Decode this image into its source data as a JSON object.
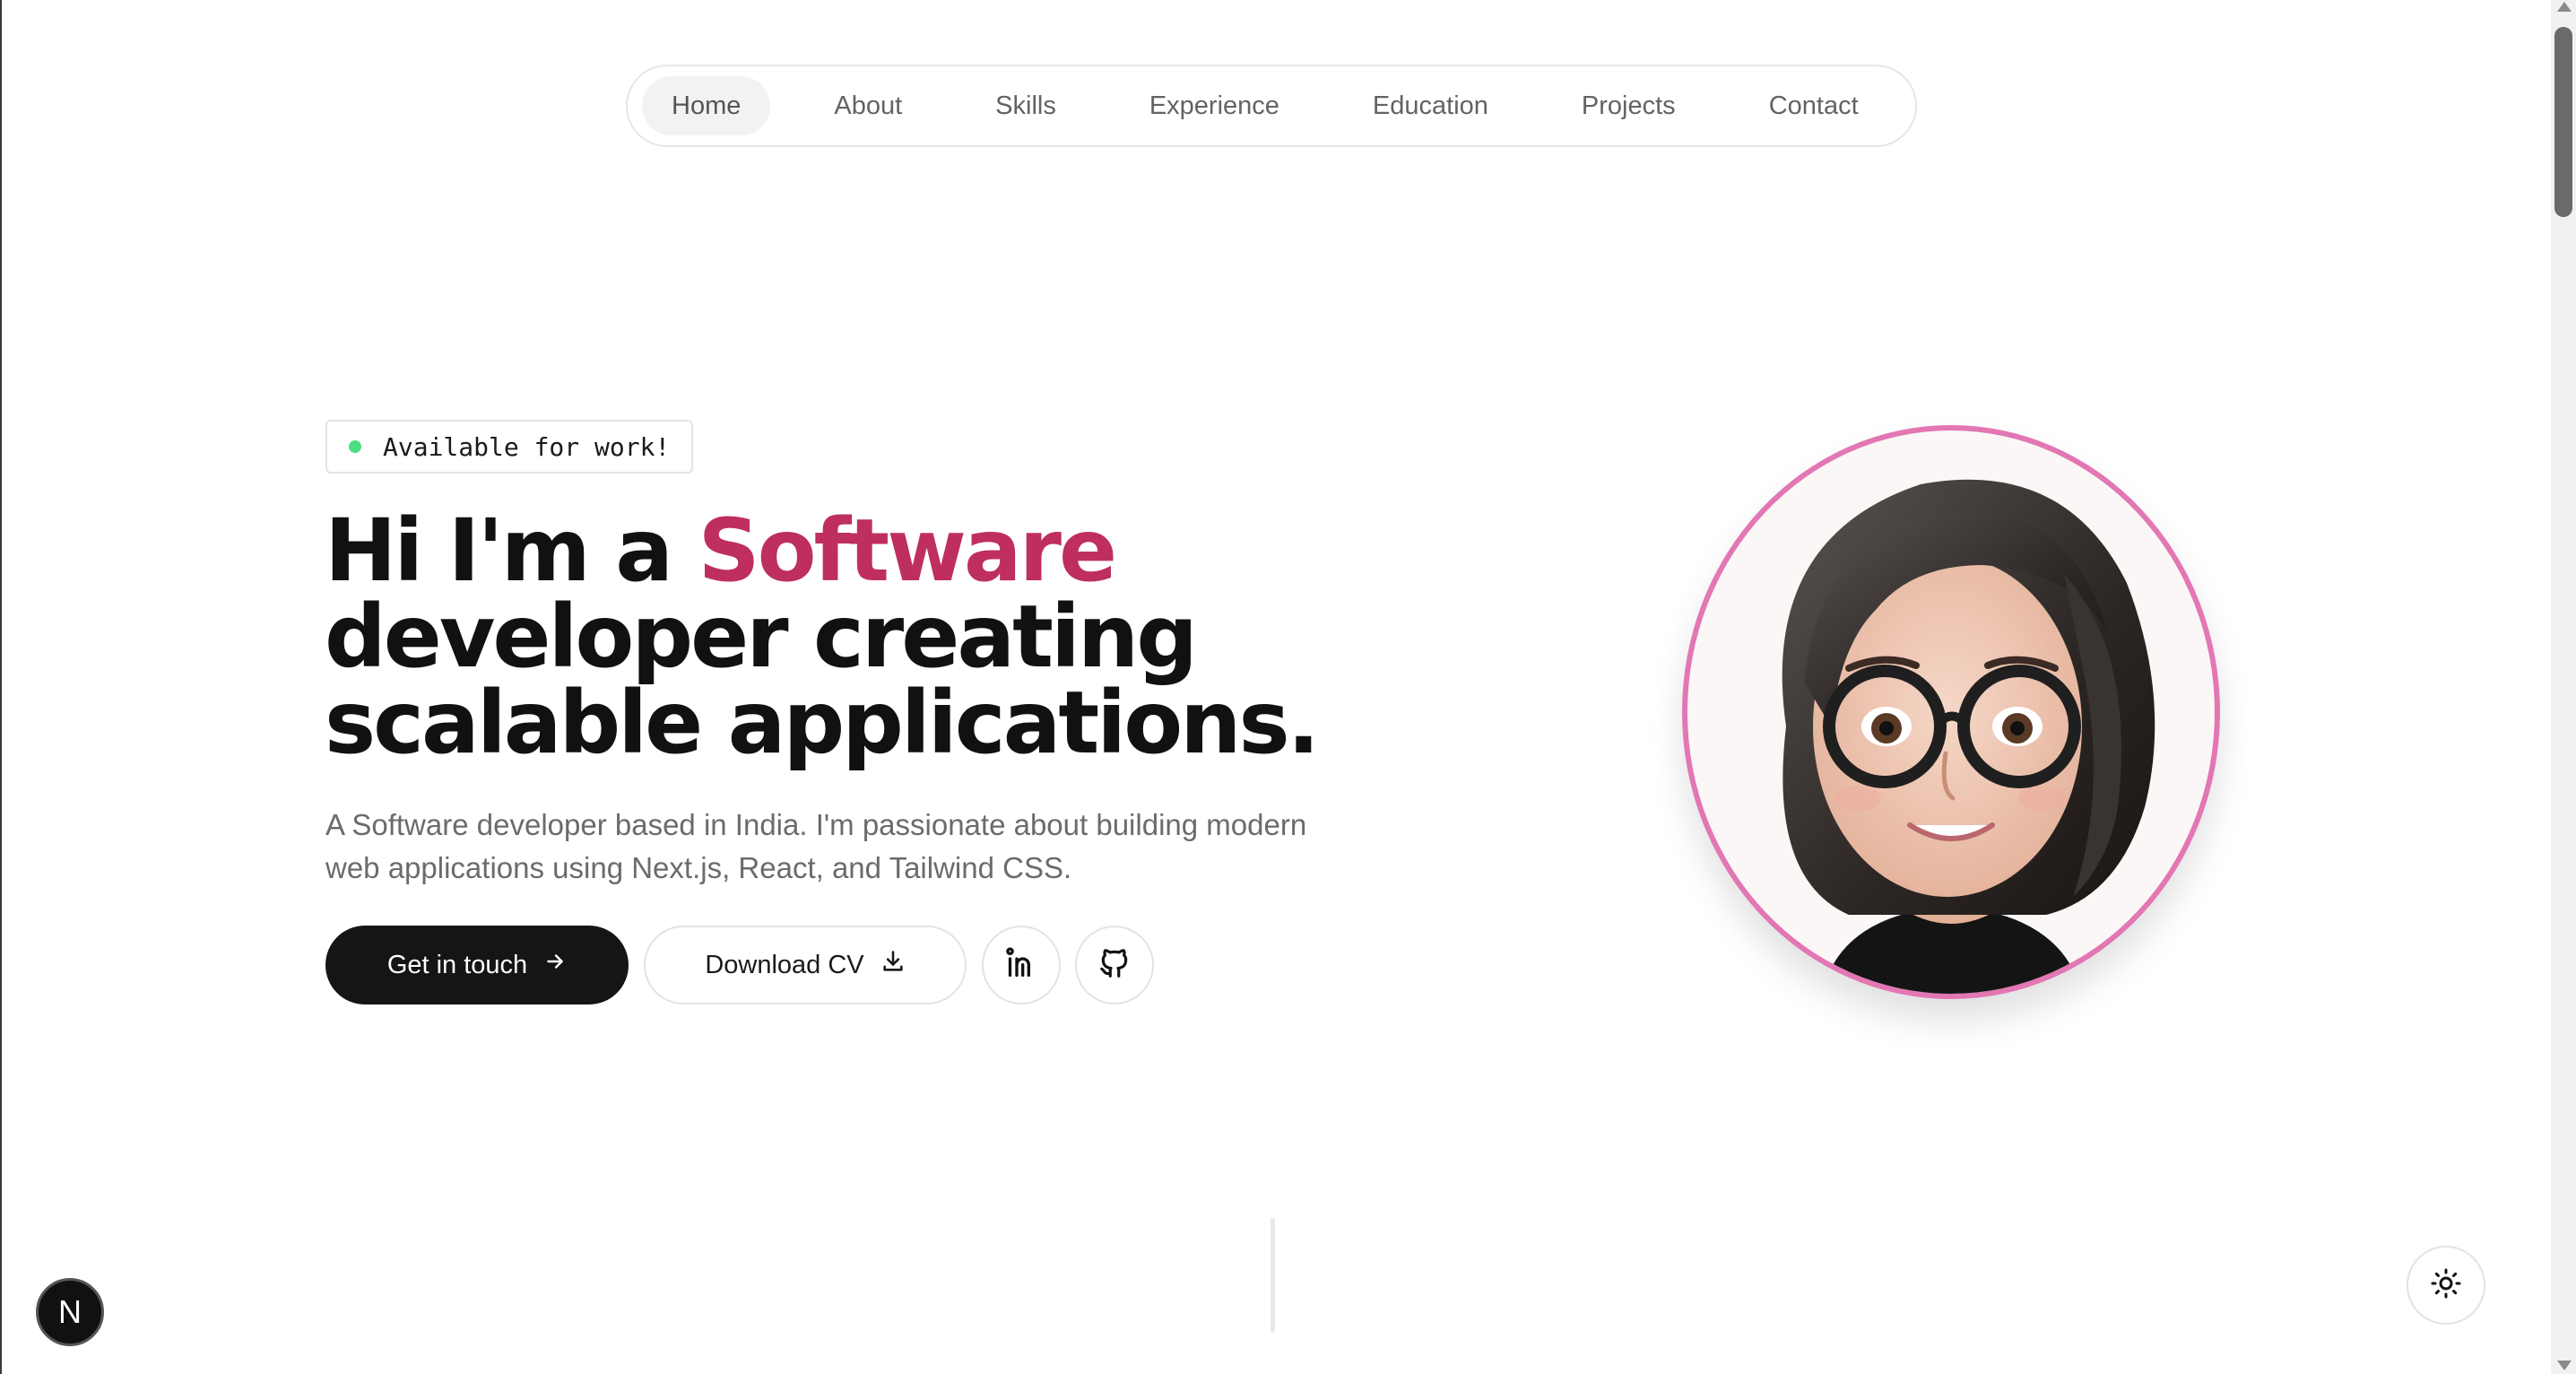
{
  "nav": {
    "items": [
      {
        "label": "Home",
        "active": true
      },
      {
        "label": "About"
      },
      {
        "label": "Skills"
      },
      {
        "label": "Experience"
      },
      {
        "label": "Education"
      },
      {
        "label": "Projects"
      },
      {
        "label": "Contact"
      }
    ]
  },
  "hero": {
    "badge": "Available for work!",
    "badge_dot_color": "#4ade80",
    "headline_before": "Hi I'm a ",
    "headline_accent": "Software",
    "headline_after": " developer creating scalable applications.",
    "accent_color": "#be2f5e",
    "description": "A Software developer based in India. I'm passionate about building modern web applications using Next.js, React, and Tailwind CSS.",
    "primary_button": "Get in touch",
    "primary_button_icon": "arrow-right-icon",
    "secondary_button": "Download CV",
    "secondary_button_icon": "download-icon",
    "social": [
      "linkedin-icon",
      "github-icon"
    ]
  },
  "avatar": {
    "icon": "avatar-illustration",
    "ring_color": "#e277b3"
  },
  "dev_badge": {
    "label": "N"
  },
  "theme_toggle": {
    "icon": "sun-icon"
  }
}
